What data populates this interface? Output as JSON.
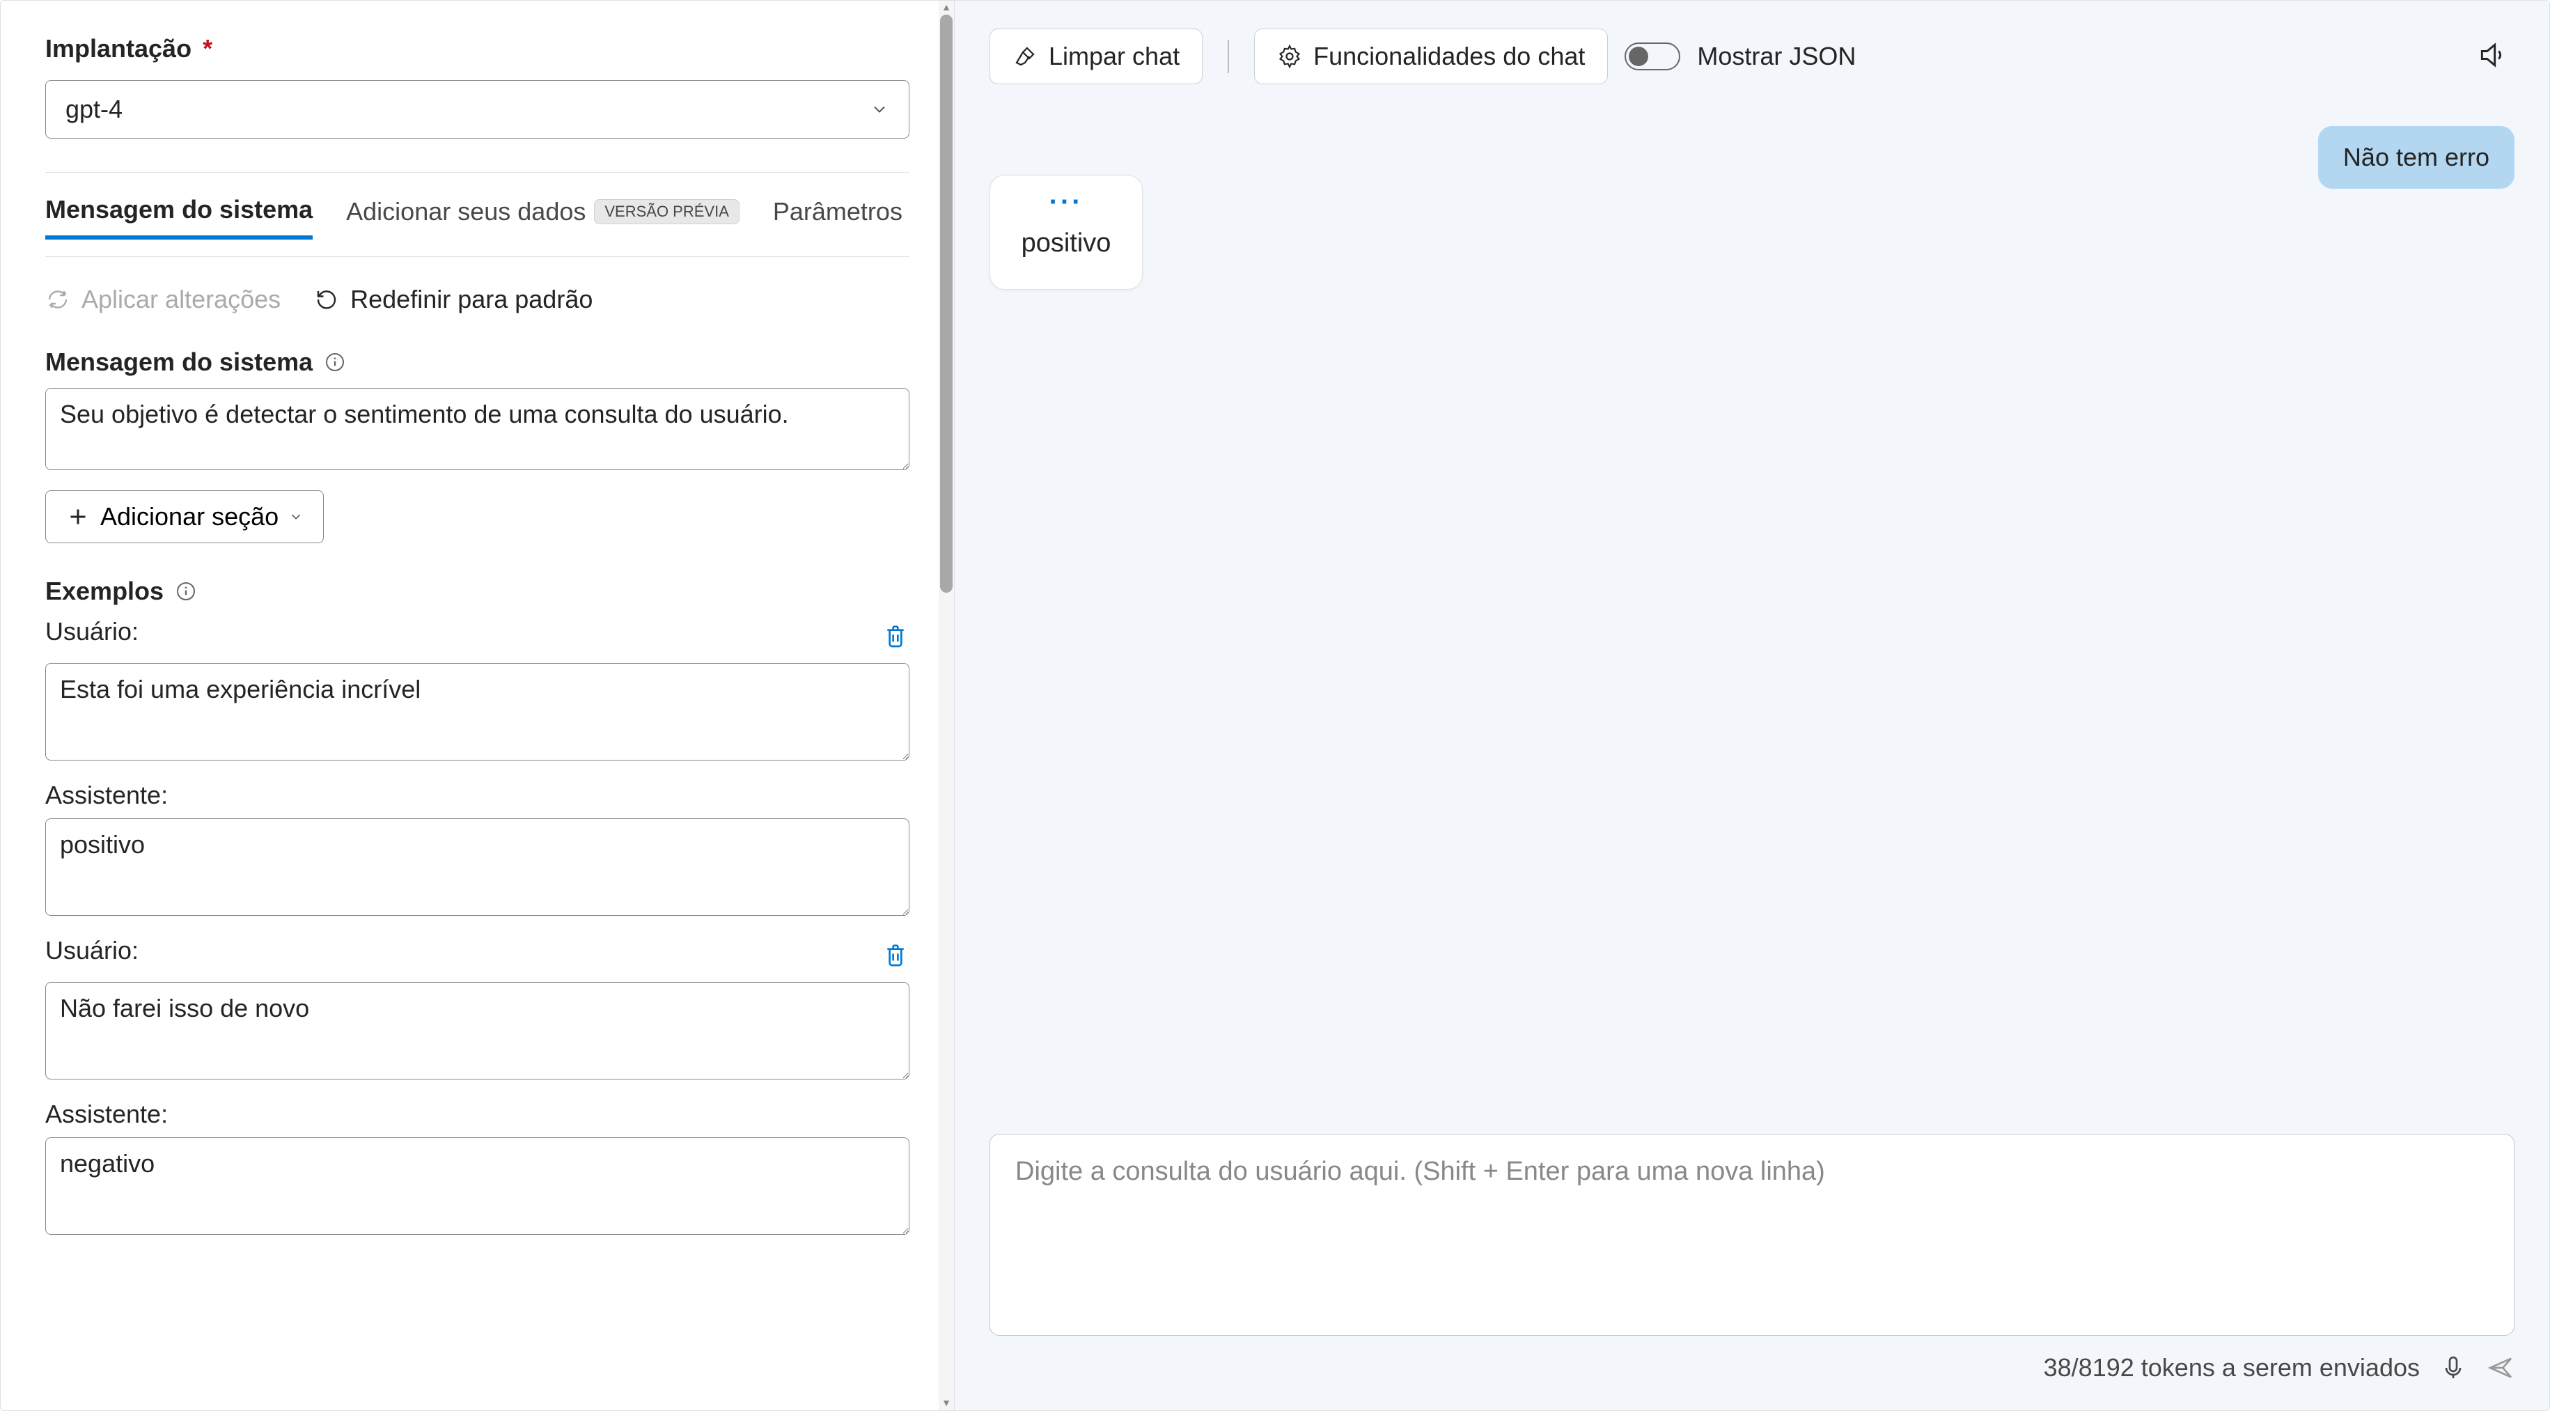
{
  "deployment": {
    "label": "Implantação",
    "required_marker": "*",
    "selected": "gpt-4"
  },
  "tabs": {
    "system_message": "Mensagem do sistema",
    "add_your_data": "Adicionar seus dados",
    "preview_badge": "VERSÃO PRÉVIA",
    "parameters": "Parâmetros"
  },
  "actions": {
    "apply_changes": "Aplicar alterações",
    "reset_default": "Redefinir para padrão"
  },
  "system_message": {
    "label": "Mensagem do sistema",
    "value": "Seu objetivo é detectar o sentimento de uma consulta do usuário."
  },
  "add_section_label": "Adicionar seção",
  "examples": {
    "label": "Exemplos",
    "user_label": "Usuário:",
    "assistant_label": "Assistente:",
    "items": [
      {
        "user": "Esta foi uma experiência incrível",
        "assistant": "positivo"
      },
      {
        "user": "Não farei isso de novo",
        "assistant": "negativo"
      }
    ]
  },
  "chat": {
    "clear_label": "Limpar chat",
    "features_label": "Funcionalidades do chat",
    "show_json_label": "Mostrar JSON",
    "user_message": "Não tem erro",
    "assistant_message": "positivo",
    "input_placeholder": "Digite a consulta do usuário aqui. (Shift + Enter para uma nova linha)",
    "token_status": "38/8192 tokens a serem enviados"
  }
}
